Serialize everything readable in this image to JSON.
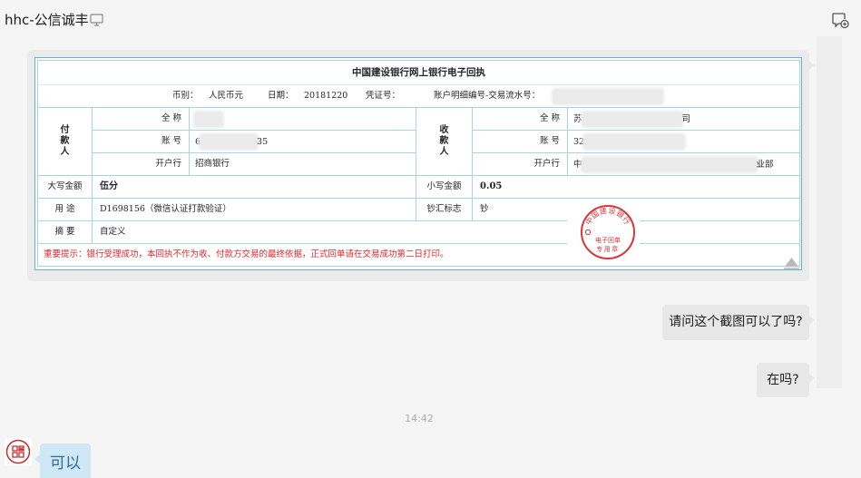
{
  "header": {
    "title": "hhc-公信诚丰",
    "icons": {
      "device": "monitor-icon",
      "new_chat": "compose-chat-icon"
    }
  },
  "receipt": {
    "title": "中国建设银行网上银行电子回执",
    "meta": {
      "currency_label": "币别：",
      "currency": "人民币元",
      "date_label": "日期：",
      "date": "20181220",
      "voucher_label": "凭证号：",
      "serial_label": "账户明细编号-交易流水号："
    },
    "payer": {
      "heading": "付款人",
      "name_label": "全 称",
      "account_label": "账 号",
      "account_prefix": "6",
      "account_suffix": "35",
      "bank_label": "开户行",
      "bank": "招商银行"
    },
    "payee": {
      "heading": "收款人",
      "name_label": "全 称",
      "name_prefix": "苏",
      "name_suffix": "司",
      "account_label": "账 号",
      "account_prefix": "32",
      "bank_label": "开户行",
      "bank_prefix": "中",
      "bank_suffix": "业部"
    },
    "amount": {
      "words_label": "大写金额",
      "words": "伍分",
      "figures_label": "小写金额",
      "figures": "0.05"
    },
    "purpose": {
      "label": "用 途",
      "value": "D1698156（微信认证打款验证）"
    },
    "cash_flag": {
      "label": "钞汇标志",
      "value": "钞"
    },
    "summary": {
      "label": "摘 要",
      "value": "自定义"
    },
    "notice": "重要提示：银行受理成功，本回执不作为收、付款方交易的最终依据，正式回单请在交易成功第二日打印。",
    "seal": {
      "ring_text": "中国建设银行",
      "line1": "电子回单",
      "line2": "专用章"
    },
    "icons": {
      "scroll_top": "triangle-up-icon"
    }
  },
  "messages": {
    "outgoing": [
      "请问这个截图可以了吗?",
      "在吗?"
    ],
    "timestamp": "14:42",
    "incoming": "可以",
    "avatar_icon": "seal-logo-avatar"
  },
  "colors": {
    "background": "#f5f5f5",
    "receipt_border": "#5fb6ca",
    "notice_red": "#e3262a",
    "seal_red": "#d8363a",
    "outgoing_bubble": "#e8e8e8",
    "incoming_bubble": "#d0e8f5"
  }
}
